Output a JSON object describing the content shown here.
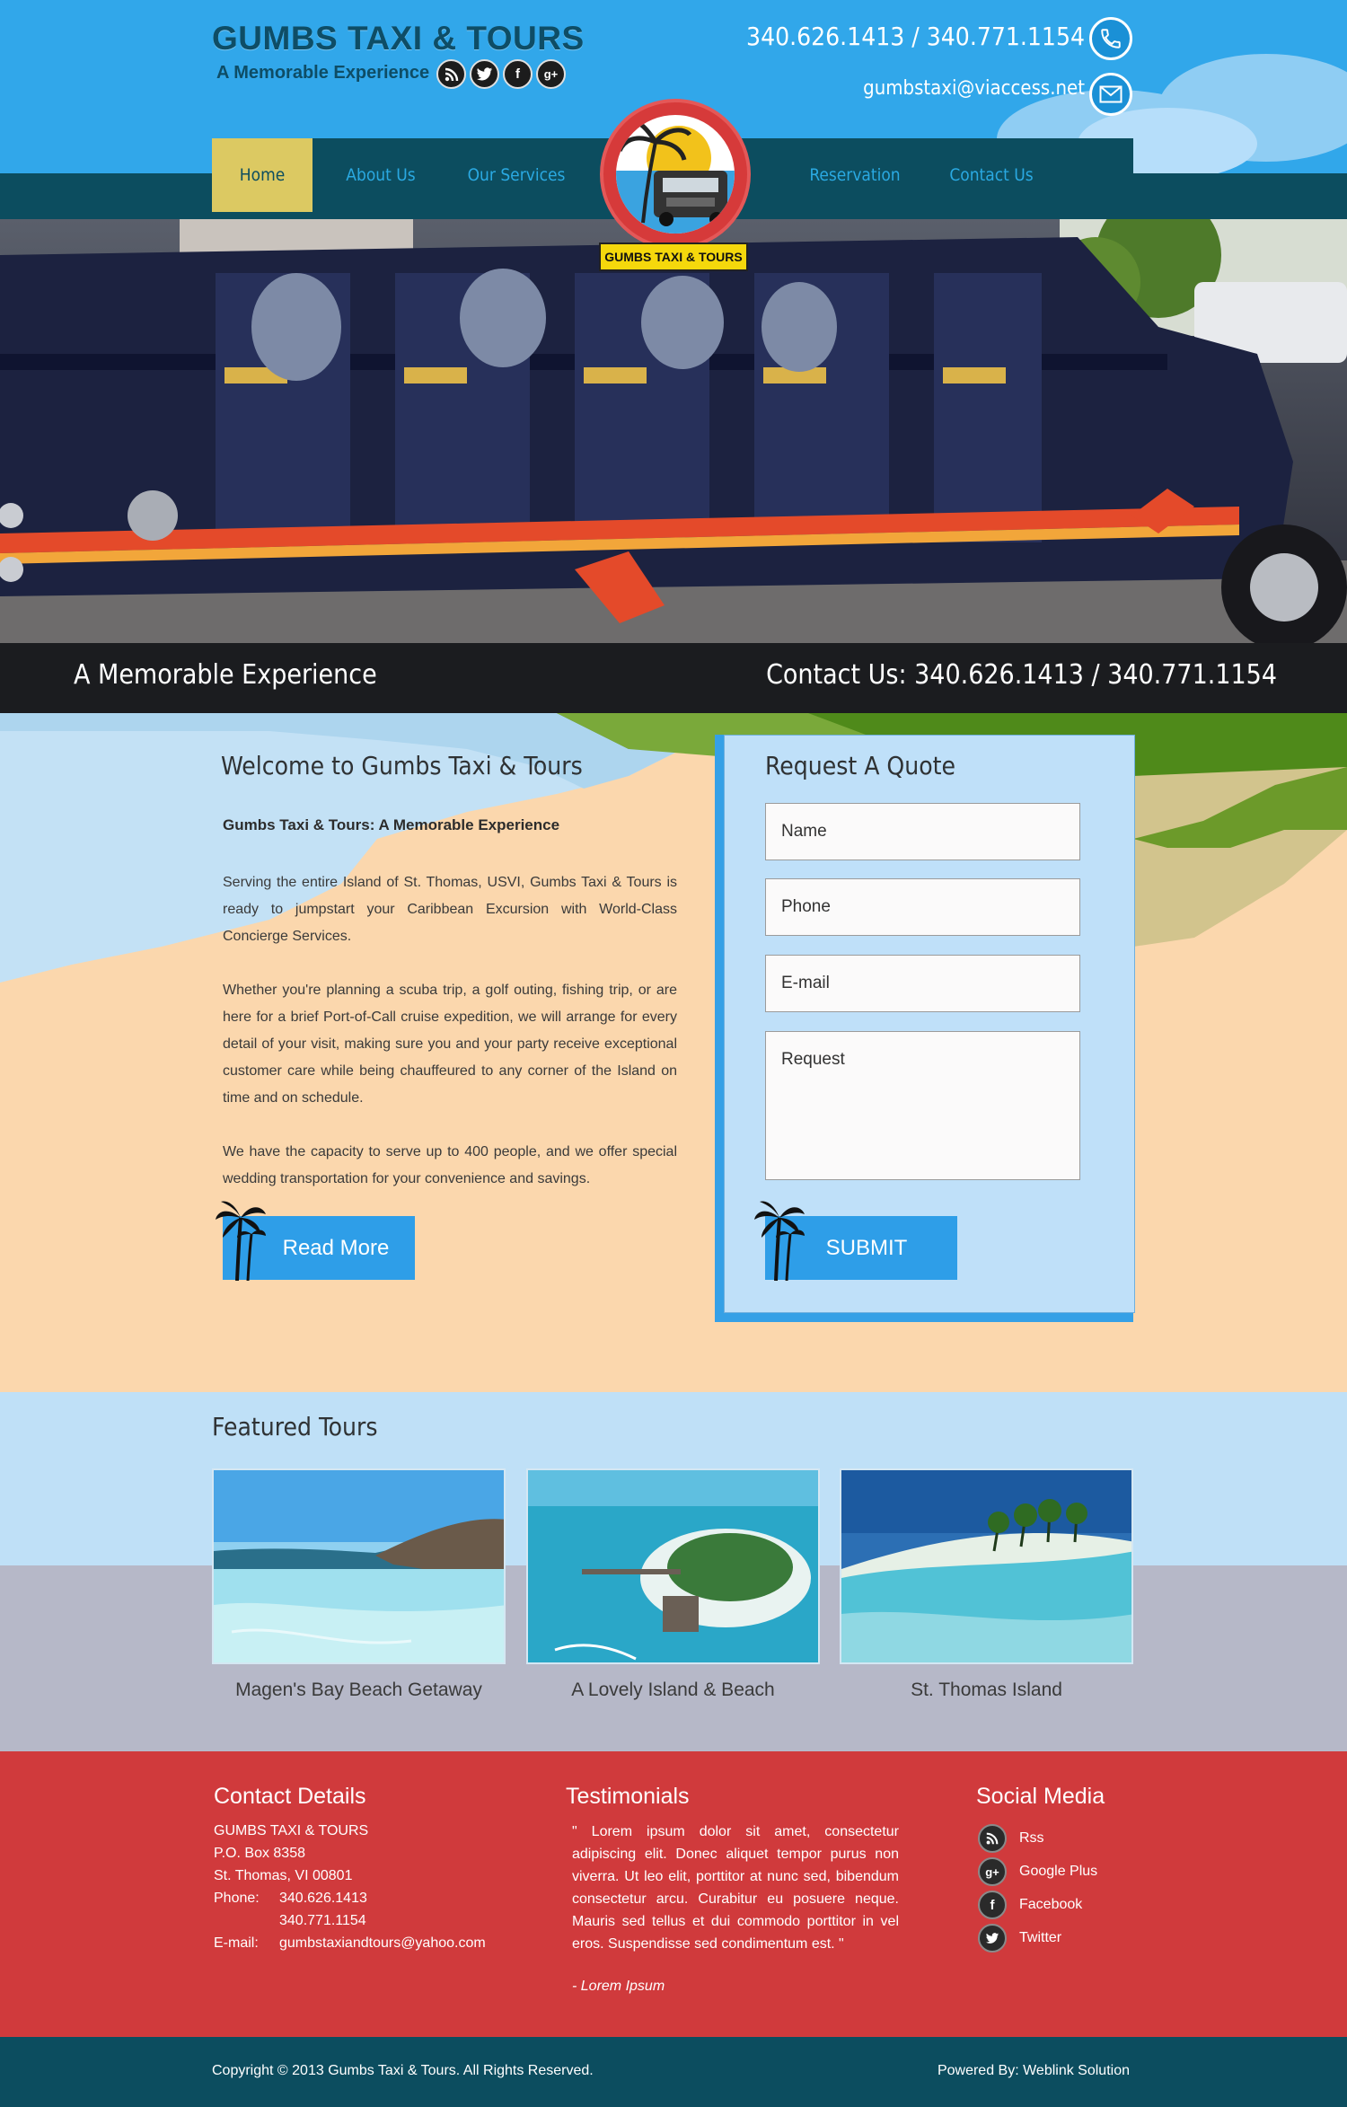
{
  "brand": {
    "title": "GUMBS TAXI & TOURS",
    "tagline": "A Memorable Experience",
    "badge_label": "GUMBS TAXI & TOURS"
  },
  "header": {
    "phone": "340.626.1413 / 340.771.1154",
    "email": "gumbstaxi@viaccess.net",
    "social_icons": [
      "rss-icon",
      "twitter-icon",
      "facebook-icon",
      "google-plus-icon"
    ]
  },
  "nav": {
    "items": [
      {
        "label": "Home",
        "active": true
      },
      {
        "label": "About Us"
      },
      {
        "label": "Our Services"
      },
      {
        "label": "Reservation"
      },
      {
        "label": "Contact Us"
      }
    ]
  },
  "hero": {
    "tagline": "A Memorable Experience",
    "contact": "Contact Us: 340.626.1413 / 340.771.1154"
  },
  "welcome": {
    "title": "Welcome to Gumbs Taxi & Tours",
    "subtitle": "Gumbs Taxi & Tours: A Memorable Experience",
    "paragraphs": [
      "Serving the entire Island of St. Thomas, USVI, Gumbs Taxi & Tours is ready to jumpstart your Caribbean Excursion with World-Class Concierge Services.",
      "Whether you're planning a scuba trip, a golf outing, fishing trip, or are here for a brief Port-of-Call cruise expedition, we will arrange for every detail of your visit, making sure you and your party receive exceptional customer care while being chauffeured to any corner of the Island on time and on schedule.",
      "We have the capacity to serve up to 400 people, and we offer special wedding transportation for your convenience and savings."
    ],
    "read_more": "Read More"
  },
  "quote": {
    "title": "Request A Quote",
    "name_placeholder": "Name",
    "phone_placeholder": "Phone",
    "email_placeholder": "E-mail",
    "request_placeholder": "Request",
    "submit": "SUBMIT"
  },
  "featured": {
    "title": "Featured Tours",
    "tours": [
      {
        "label": "Magen's Bay Beach Getaway"
      },
      {
        "label": "A Lovely Island & Beach"
      },
      {
        "label": "St. Thomas Island"
      }
    ]
  },
  "footer": {
    "contact": {
      "heading": "Contact Details",
      "company": "GUMBS TAXI & TOURS",
      "po_box": "P.O. Box 8358",
      "city": "St. Thomas, VI 00801",
      "phone_label": "Phone:",
      "phone1": "340.626.1413",
      "phone2": "340.771.1154",
      "email_label": "E-mail:",
      "email": "gumbstaxiandtours@yahoo.com"
    },
    "testimonials": {
      "heading": "Testimonials",
      "quote": "\" Lorem ipsum dolor sit amet, consectetur adipiscing elit. Donec aliquet tempor purus non viverra. Ut leo elit, porttitor at nunc sed, bibendum consectetur arcu. Curabitur eu posuere neque. Mauris sed tellus et dui commodo porttitor in vel eros. Suspendisse sed condimentum est. \"",
      "author": "- Lorem Ipsum"
    },
    "social": {
      "heading": "Social Media",
      "items": [
        {
          "label": "Rss",
          "icon": "rss-icon"
        },
        {
          "label": "Google Plus",
          "icon": "google-plus-icon"
        },
        {
          "label": "Facebook",
          "icon": "facebook-icon"
        },
        {
          "label": "Twitter",
          "icon": "twitter-icon"
        }
      ]
    },
    "copyright": "Copyright © 2013 Gumbs Taxi & Tours. All Rights Reserved.",
    "powered_by": "Powered By: Weblink Solution"
  }
}
